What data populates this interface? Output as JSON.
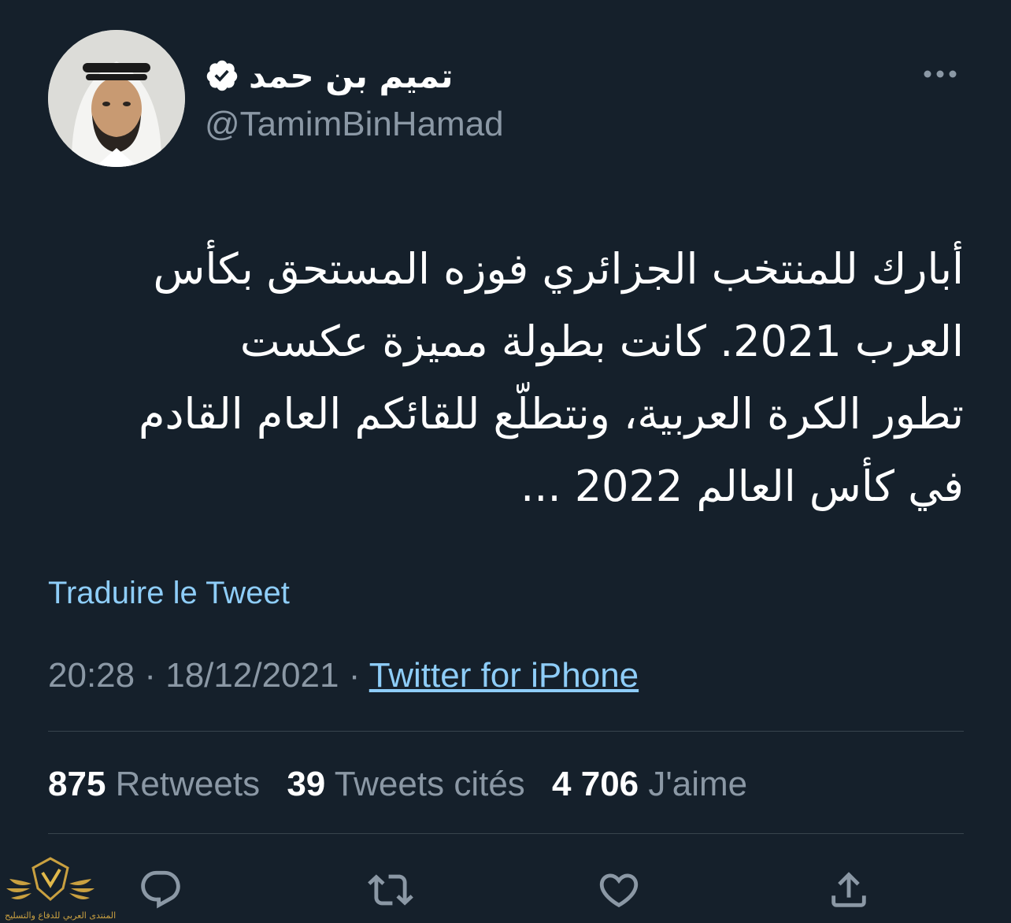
{
  "author": {
    "display_name": "تميم بن حمد",
    "handle": "@TamimBinHamad",
    "avatar_icon": "profile-photo",
    "verified_icon": "verified-badge-icon"
  },
  "menu": {
    "more_icon": "more-options-icon"
  },
  "tweet": {
    "lines": [
      "أبارك للمنتخب الجزائري فوزه المستحق بكأس",
      "العرب 2021. كانت بطولة مميزة عكست",
      "تطور الكرة العربية، ونتطلّع للقائكم العام القادم",
      "في كأس العالم 2022 ..."
    ],
    "translate_label": "Traduire le Tweet"
  },
  "meta": {
    "time": "20:28",
    "separator": "·",
    "date": "18/12/2021",
    "source": "Twitter for iPhone"
  },
  "stats": {
    "retweets_count": "875",
    "retweets_label": "Retweets",
    "quotes_count": "39",
    "quotes_label": "Tweets cités",
    "likes_count": "4 706",
    "likes_label": "J'aime"
  },
  "actions": [
    "reply-icon",
    "retweet-icon",
    "like-icon",
    "share-icon"
  ],
  "watermark": {
    "text": "المنتدى العربي للدفاع والتسليح"
  },
  "colors": {
    "background": "#15202b",
    "primary_text": "#ffffff",
    "secondary_text": "#8b98a5",
    "link": "#8ecdf8",
    "divider": "#38444d"
  }
}
